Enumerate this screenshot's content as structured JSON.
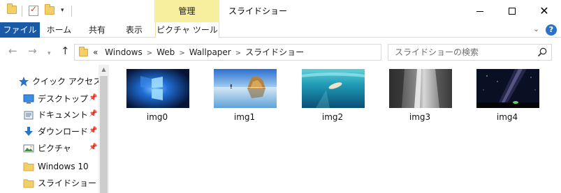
{
  "window": {
    "title": "スライドショー",
    "context_tab_header": "管理"
  },
  "quick_access_toolbar": {
    "dropdown_glyph": "▾"
  },
  "ribbon": {
    "tabs": [
      {
        "label": "ファイル"
      },
      {
        "label": "ホーム"
      },
      {
        "label": "共有"
      },
      {
        "label": "表示"
      },
      {
        "label": "ピクチャ ツール"
      }
    ]
  },
  "address_bar": {
    "overflow": "«",
    "crumbs": [
      "Windows",
      "Web",
      "Wallpaper",
      "スライドショー"
    ]
  },
  "search": {
    "placeholder": "スライドショーの検索"
  },
  "nav_pane": {
    "items": [
      {
        "label": "クイック アクセス",
        "icon": "star-icon",
        "pinned": false
      },
      {
        "label": "デスクトップ",
        "icon": "desktop-icon",
        "pinned": true
      },
      {
        "label": "ドキュメント",
        "icon": "documents-icon",
        "pinned": true
      },
      {
        "label": "ダウンロード",
        "icon": "download-icon",
        "pinned": true
      },
      {
        "label": "ピクチャ",
        "icon": "pictures-icon",
        "pinned": true
      },
      {
        "label": "Windows 10",
        "icon": "folder-icon",
        "pinned": false
      },
      {
        "label": "スライドショー",
        "icon": "folder-icon",
        "pinned": false
      }
    ]
  },
  "files": [
    {
      "name": "img0"
    },
    {
      "name": "img1"
    },
    {
      "name": "img2"
    },
    {
      "name": "img3"
    },
    {
      "name": "img4"
    }
  ],
  "colors": {
    "file_tab": "#195aa8",
    "context_header": "#f7ef9e",
    "accent_blue": "#2b73c7",
    "folder_yellow": "#f3cf6a"
  }
}
